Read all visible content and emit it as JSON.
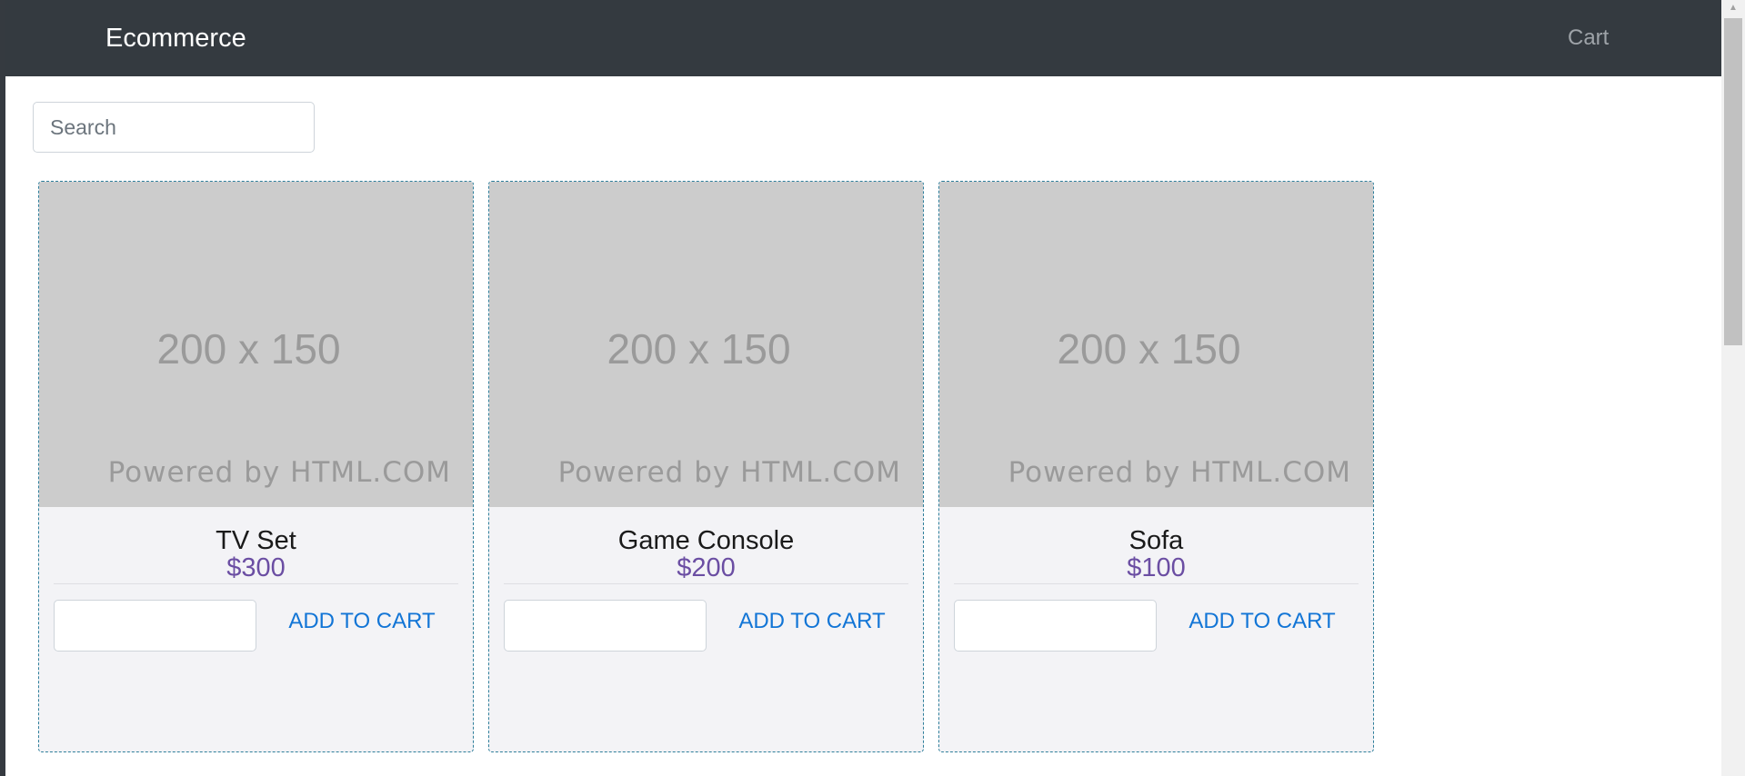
{
  "navbar": {
    "brand": "Ecommerce",
    "cart_label": "Cart"
  },
  "search": {
    "placeholder": "Search",
    "value": ""
  },
  "products": [
    {
      "image_dim_text": "200 x 150",
      "image_powered_text": "Powered by HTML.COM",
      "name": "TV Set",
      "price": "$300",
      "quantity_value": "",
      "add_label": "ADD TO CART"
    },
    {
      "image_dim_text": "200 x 150",
      "image_powered_text": "Powered by HTML.COM",
      "name": "Game Console",
      "price": "$200",
      "quantity_value": "",
      "add_label": "ADD TO CART"
    },
    {
      "image_dim_text": "200 x 150",
      "image_powered_text": "Powered by HTML.COM",
      "name": "Sofa",
      "price": "$100",
      "quantity_value": "",
      "add_label": "ADD TO CART"
    }
  ],
  "colors": {
    "navbar_bg": "#343a40",
    "price": "#6b4ea3",
    "link": "#1275d6",
    "card_bg": "#f3f3f6",
    "card_border": "#2f7f9b",
    "placeholder_image": "#cccccc"
  },
  "icons": {
    "scroll_up": "scroll-up-arrow-icon"
  }
}
